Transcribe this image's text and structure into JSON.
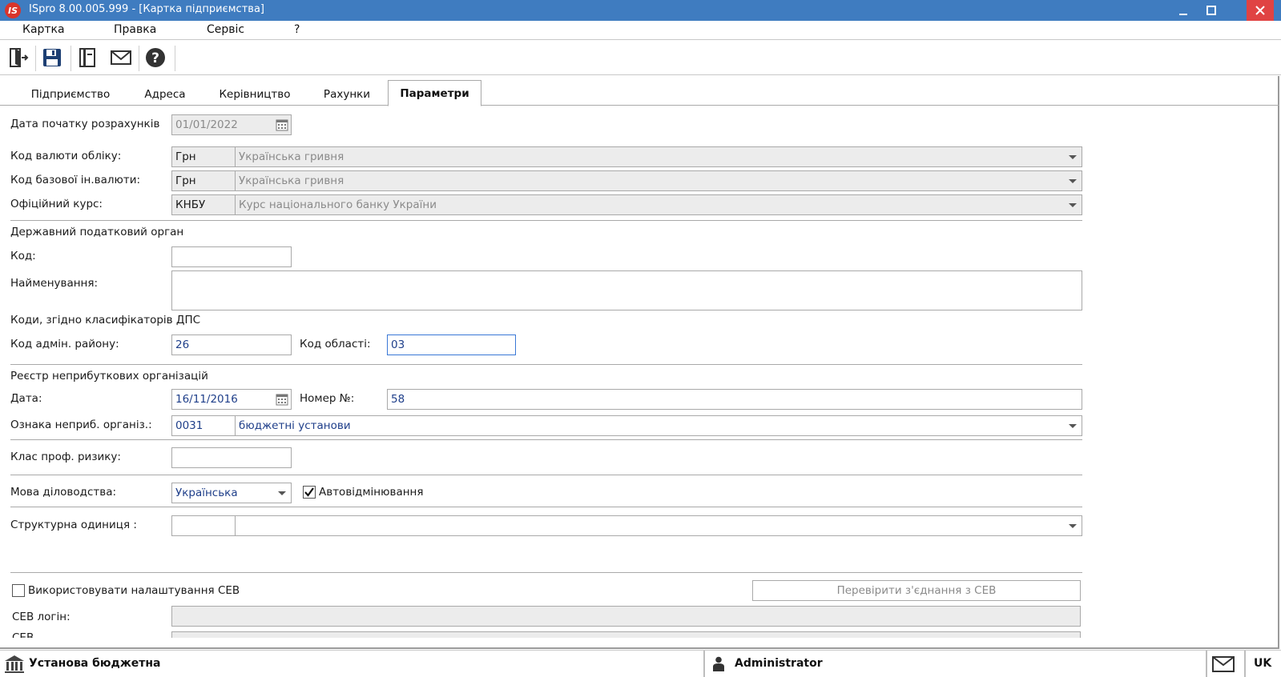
{
  "window": {
    "title": "ISpro 8.00.005.999 - [Картка підприємства]",
    "logo_text": "IS",
    "minimize_icon": "minimize-icon",
    "maximize_icon": "maximize-icon",
    "close_icon": "close-icon"
  },
  "menu": {
    "items": [
      "Картка",
      "Правка",
      "Сервіс",
      "?"
    ]
  },
  "toolbar": {
    "buttons": [
      "exit-icon",
      "save-icon",
      "document-icon",
      "mail-icon",
      "help-icon"
    ]
  },
  "tabs": {
    "items": [
      "Підприємство",
      "Адреса",
      "Керівництво",
      "Рахунки",
      "Параметри"
    ],
    "active": "Параметри"
  },
  "form": {
    "start_date_label": "Дата початку розрахунків",
    "start_date_value": "01/01/2022",
    "currency_label": "Код валюти обліку:",
    "currency_code": "Грн",
    "currency_name": "Українська гривня",
    "base_currency_label": "Код базової ін.валюти:",
    "base_currency_code": "Грн",
    "base_currency_name": "Українська гривня",
    "official_rate_label": "Офіційний курс:",
    "official_rate_code": "КНБУ",
    "official_rate_name": "Курс національного банку України",
    "tax_authority_header": "Державний податковий орган",
    "tax_code_label": "Код:",
    "tax_code_value": "",
    "tax_name_label": "Найменування:",
    "tax_name_value": "",
    "dps_codes_header": "Коди, згідно класифікаторів ДПС",
    "district_label": "Код адмін. району:",
    "district_value": "26",
    "region_label": "Код області:",
    "region_value": "03",
    "nonprofit_header": "Реєстр неприбуткових організацій",
    "np_date_label": "Дата:",
    "np_date_value": "16/11/2016",
    "np_number_label": "Номер №:",
    "np_number_value": "58",
    "np_sign_label": "Ознака неприб. організ.:",
    "np_sign_code": "0031",
    "np_sign_name": "бюджетні установи",
    "risk_class_label": "Клас проф. ризику:",
    "risk_class_value": "",
    "language_label": "Мова діловодства:",
    "language_value": "Українська",
    "auto_decline_label": "Автовідмінювання",
    "auto_decline_checked": true,
    "struct_unit_label": "Структурна одиниця :",
    "struct_unit_code": "",
    "struct_unit_name": "",
    "sev_use_label": "Використовувати налаштування СЕВ",
    "sev_use_checked": false,
    "sev_check_button": "Перевірити з'єднання з СЕВ",
    "sev_login_label": "СЕВ логін:",
    "sev_login_value": "",
    "sev_partial_label": "СЕВ"
  },
  "status": {
    "organization": "Установа бюджетна",
    "user": "Administrator",
    "language": "UK",
    "org_icon": "building-icon",
    "user_icon": "user-icon",
    "mail_icon": "mail-icon"
  },
  "colors": {
    "titlebar": "#3f7cc0",
    "close_button": "#e04343",
    "value_text": "#1f3f8a",
    "disabled_bg": "#ececec"
  }
}
